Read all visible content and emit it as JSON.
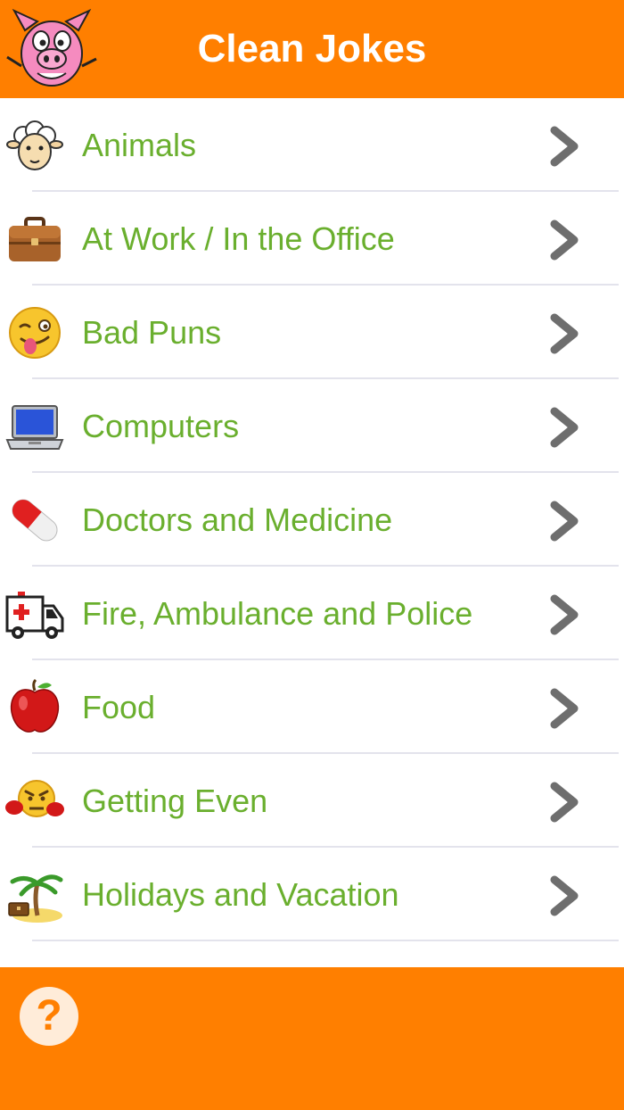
{
  "header": {
    "title": "Clean Jokes",
    "logo_icon": "pig-mascot-icon"
  },
  "list": {
    "items": [
      {
        "label": "Animals",
        "icon": "sheep-icon"
      },
      {
        "label": "At Work / In the Office",
        "icon": "briefcase-icon"
      },
      {
        "label": "Bad Puns",
        "icon": "winking-tongue-face-icon"
      },
      {
        "label": "Computers",
        "icon": "laptop-icon"
      },
      {
        "label": "Doctors and Medicine",
        "icon": "pill-capsule-icon"
      },
      {
        "label": "Fire, Ambulance and Police",
        "icon": "ambulance-icon"
      },
      {
        "label": "Food",
        "icon": "apple-icon"
      },
      {
        "label": "Getting Even",
        "icon": "angry-boxer-face-icon"
      },
      {
        "label": "Holidays and Vacation",
        "icon": "palm-tree-island-icon"
      }
    ]
  },
  "footer": {
    "help_label": "?",
    "help_icon": "question-mark-icon"
  },
  "colors": {
    "accent": "#ff7f00",
    "label_green": "#6aaf2e",
    "chevron_gray": "#6e6e6e",
    "separator": "#e3e3ec"
  }
}
